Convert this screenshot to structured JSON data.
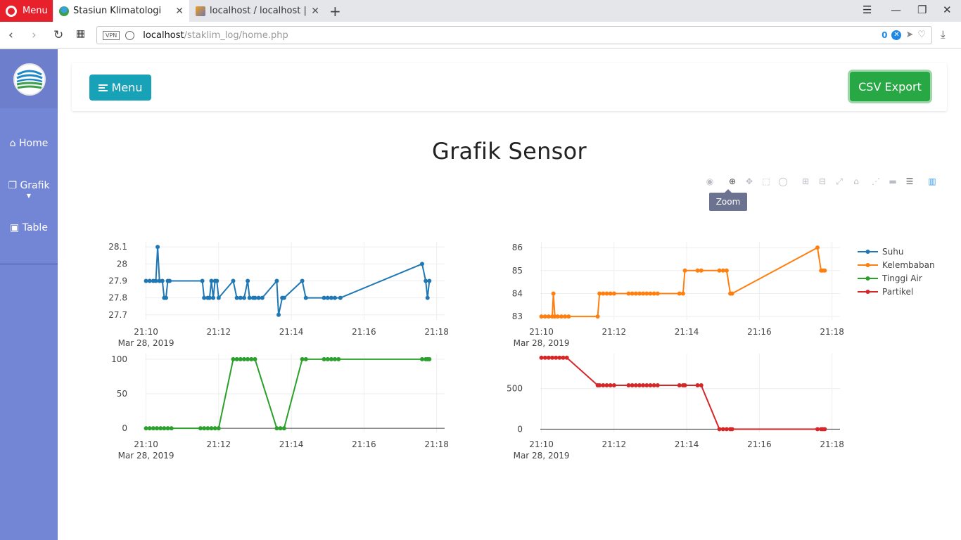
{
  "browser": {
    "menu_label": "Menu",
    "tabs": [
      {
        "title": "Stasiun Klimatologi",
        "active": true
      },
      {
        "title": "localhost / localhost | ph",
        "active": false
      }
    ],
    "url_host": "localhost",
    "url_path": "/staklim_log/home.php",
    "vpn_label": "VPN",
    "badge_count": "0"
  },
  "sidebar": {
    "items": [
      {
        "label": "Home",
        "icon": "home-icon"
      },
      {
        "label": "Grafik",
        "icon": "copy-icon"
      },
      {
        "label": "Table",
        "icon": "briefcase-icon"
      }
    ]
  },
  "header": {
    "menu_button": "Menu",
    "csv_button": "CSV Export"
  },
  "page": {
    "title": "Grafik Sensor"
  },
  "modebar": {
    "tooltip": "Zoom",
    "icons": [
      "camera-icon",
      "zoom-icon",
      "pan-icon",
      "box-select-icon",
      "lasso-icon",
      "zoom-in-icon",
      "zoom-out-icon",
      "autoscale-icon",
      "reset-axes-icon",
      "spike-lines-icon",
      "hover-closest-icon",
      "hover-compare-icon",
      "plotly-logo-icon"
    ]
  },
  "chart_data": {
    "type": "line",
    "x_axis": {
      "tick_labels": [
        "21:10",
        "21:12",
        "21:14",
        "21:16",
        "21:18"
      ],
      "date_label": "Mar 28, 2019",
      "range": [
        -0.03,
        8.22
      ]
    },
    "legend": {
      "placement": "right",
      "entries": [
        "Suhu",
        "Kelembaban",
        "Tinggi Air",
        "Partikel"
      ]
    },
    "subplots": [
      {
        "series": "Suhu",
        "color": "#1f77b4",
        "y_ticks": [
          27.7,
          27.8,
          27.9,
          28,
          28.1
        ],
        "y_tick_labels": [
          "27.7",
          "27.8",
          "27.9",
          "28",
          "28.1"
        ],
        "ylim": [
          27.67,
          28.13
        ],
        "x": [
          0.0,
          0.1,
          0.2,
          0.27,
          0.32,
          0.37,
          0.45,
          0.5,
          0.55,
          0.6,
          0.65,
          1.55,
          1.6,
          1.7,
          1.75,
          1.8,
          1.85,
          1.9,
          1.95,
          2.0,
          2.4,
          2.5,
          2.6,
          2.7,
          2.8,
          2.85,
          2.95,
          3.0,
          3.1,
          3.2,
          3.6,
          3.65,
          3.75,
          3.8,
          4.3,
          4.4,
          4.9,
          5.0,
          5.1,
          5.2,
          5.35,
          7.6,
          7.7,
          7.75,
          7.8
        ],
        "y": [
          27.9,
          27.9,
          27.9,
          27.9,
          28.1,
          27.9,
          27.9,
          27.8,
          27.8,
          27.9,
          27.9,
          27.9,
          27.8,
          27.8,
          27.8,
          27.9,
          27.8,
          27.9,
          27.9,
          27.8,
          27.9,
          27.8,
          27.8,
          27.8,
          27.9,
          27.8,
          27.8,
          27.8,
          27.8,
          27.8,
          27.9,
          27.7,
          27.8,
          27.8,
          27.9,
          27.8,
          27.8,
          27.8,
          27.8,
          27.8,
          27.8,
          28,
          27.9,
          27.8,
          27.9
        ]
      },
      {
        "series": "Kelembaban",
        "color": "#ff7f0e",
        "y_ticks": [
          83,
          84,
          85,
          86
        ],
        "y_tick_labels": [
          "83",
          "84",
          "85",
          "86"
        ],
        "ylim": [
          82.85,
          86.25
        ],
        "x": [
          0.0,
          0.1,
          0.2,
          0.3,
          0.33,
          0.37,
          0.45,
          0.55,
          0.65,
          0.75,
          1.55,
          1.6,
          1.7,
          1.8,
          1.9,
          2.0,
          2.4,
          2.5,
          2.6,
          2.7,
          2.8,
          2.9,
          3.0,
          3.1,
          3.2,
          3.8,
          3.9,
          3.95,
          4.3,
          4.4,
          4.9,
          5.0,
          5.1,
          5.2,
          5.25,
          7.6,
          7.7,
          7.75,
          7.8
        ],
        "y": [
          83,
          83,
          83,
          83,
          84,
          83,
          83,
          83,
          83,
          83,
          83,
          84,
          84,
          84,
          84,
          84,
          84,
          84,
          84,
          84,
          84,
          84,
          84,
          84,
          84,
          84,
          84,
          85,
          85,
          85,
          85,
          85,
          85,
          84,
          84,
          86,
          85,
          85,
          85
        ]
      },
      {
        "series": "Tinggi Air",
        "color": "#2ca02c",
        "y_ticks": [
          0,
          50,
          100
        ],
        "y_tick_labels": [
          "0",
          "50",
          "100"
        ],
        "ylim": [
          -6,
          108
        ],
        "x": [
          0.0,
          0.1,
          0.2,
          0.3,
          0.4,
          0.5,
          0.6,
          0.7,
          1.5,
          1.6,
          1.7,
          1.8,
          1.9,
          2.0,
          2.4,
          2.5,
          2.6,
          2.7,
          2.8,
          2.9,
          3.0,
          3.6,
          3.7,
          3.8,
          4.3,
          4.4,
          4.9,
          5.0,
          5.1,
          5.2,
          5.3,
          7.6,
          7.7,
          7.75,
          7.8
        ],
        "y": [
          0,
          0,
          0,
          0,
          0,
          0,
          0,
          0,
          0,
          0,
          0,
          0,
          0,
          0,
          100,
          100,
          100,
          100,
          100,
          100,
          100,
          0,
          0,
          0,
          100,
          100,
          100,
          100,
          100,
          100,
          100,
          100,
          100,
          100,
          100
        ]
      },
      {
        "series": "Partikel",
        "color": "#d62728",
        "y_ticks": [
          0,
          500
        ],
        "y_tick_labels": [
          "0",
          "500"
        ],
        "ylim": [
          -40,
          930
        ],
        "x": [
          0.0,
          0.1,
          0.2,
          0.3,
          0.4,
          0.5,
          0.6,
          0.7,
          1.55,
          1.6,
          1.7,
          1.8,
          1.9,
          2.0,
          2.4,
          2.5,
          2.6,
          2.7,
          2.8,
          2.9,
          3.0,
          3.1,
          3.2,
          3.8,
          3.9,
          3.95,
          4.3,
          4.4,
          4.9,
          5.0,
          5.1,
          5.2,
          5.25,
          7.6,
          7.7,
          7.75,
          7.8
        ],
        "y": [
          880,
          880,
          880,
          880,
          880,
          880,
          880,
          880,
          540,
          540,
          540,
          540,
          540,
          540,
          540,
          540,
          540,
          540,
          540,
          540,
          540,
          540,
          540,
          540,
          540,
          540,
          540,
          540,
          0,
          0,
          0,
          0,
          0,
          0,
          0,
          0,
          0
        ]
      }
    ]
  }
}
